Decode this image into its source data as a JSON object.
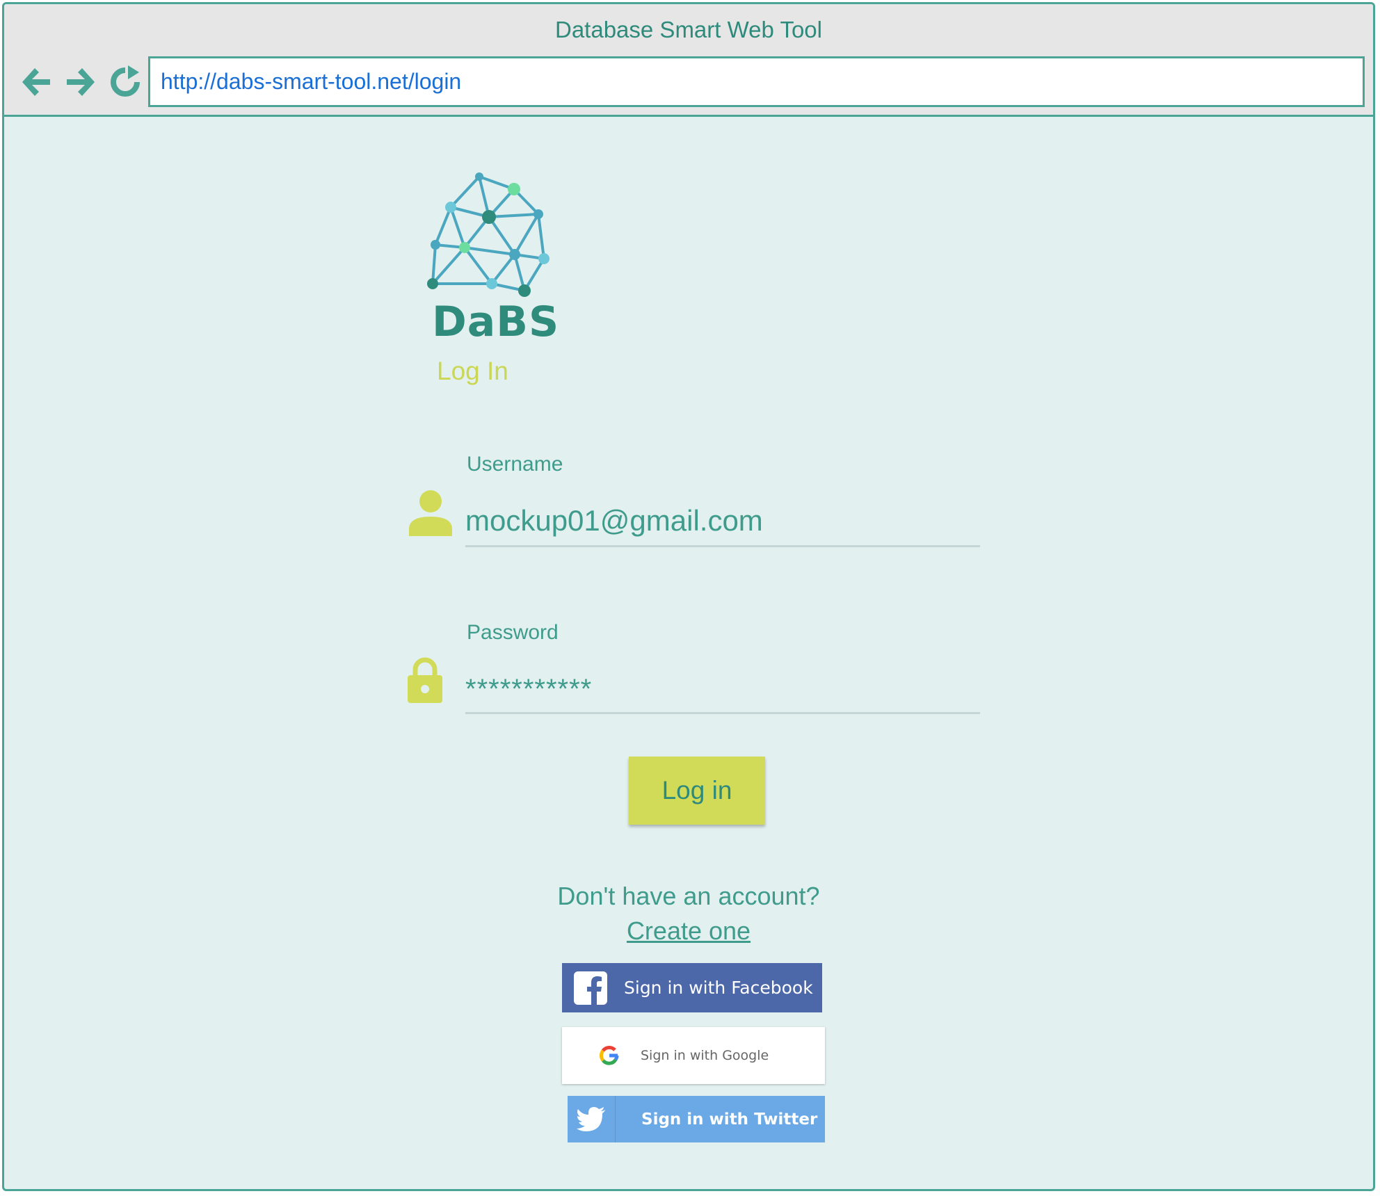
{
  "browser": {
    "title": "Database Smart Web Tool",
    "url": "http://dabs-smart-tool.net/login"
  },
  "logo": {
    "text": "DaBS"
  },
  "page": {
    "heading": "Log In"
  },
  "form": {
    "username_label": "Username",
    "username_value": "mockup01@gmail.com",
    "password_label": "Password",
    "password_value": "***********",
    "login_button": "Log in"
  },
  "signup": {
    "prompt": "Don't have an account?",
    "link": "Create one"
  },
  "social": {
    "facebook": "Sign in with Facebook",
    "google": "Sign in with Google",
    "twitter": "Sign in with Twitter"
  },
  "colors": {
    "accent": "#4aa597",
    "yellow": "#d2db58",
    "facebook": "#4d68a8",
    "twitter": "#6aa9e5"
  }
}
